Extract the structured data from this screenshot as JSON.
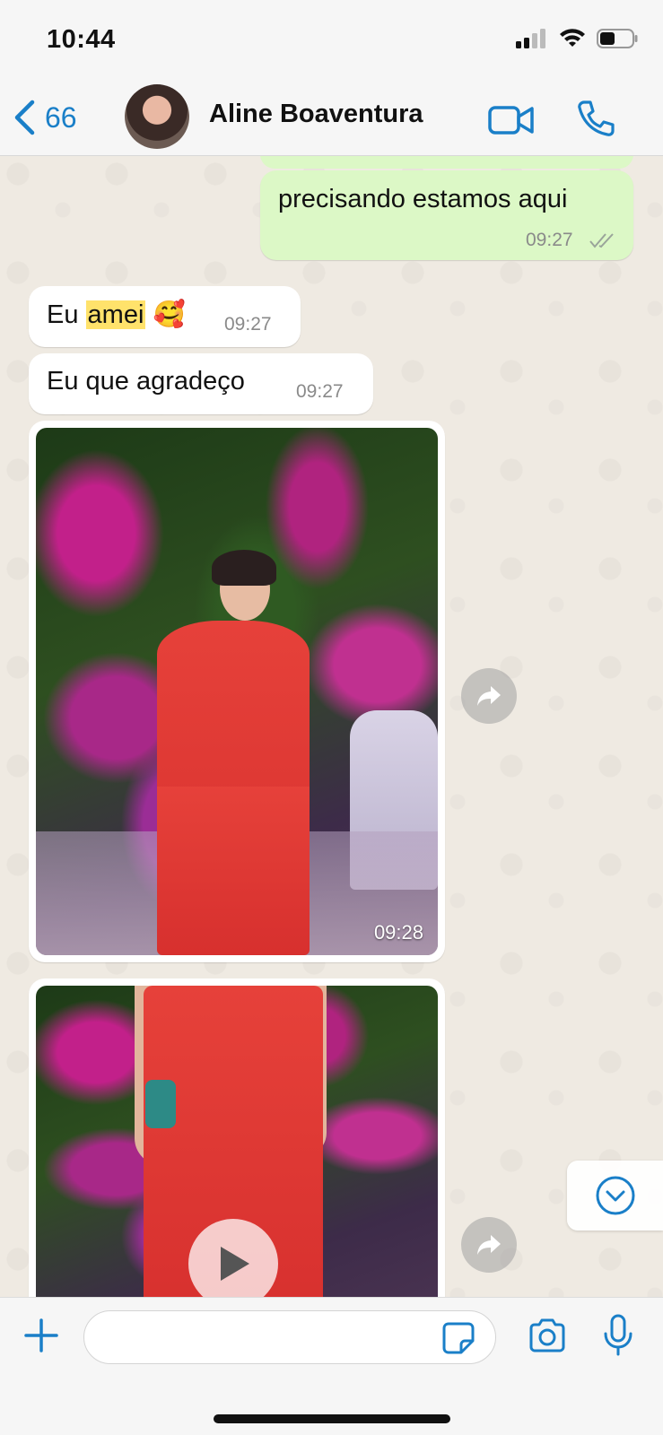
{
  "status_bar": {
    "time": "10:44"
  },
  "header": {
    "back_count": "66",
    "contact_name": "Aline Boaventura"
  },
  "messages": [
    {
      "direction": "out",
      "text": "precisando estamos aqui",
      "time": "09:27",
      "read": true
    },
    {
      "direction": "in",
      "text_before": "Eu ",
      "text_highlight": "amei",
      "emoji": "🥰",
      "time": "09:27"
    },
    {
      "direction": "in",
      "text": "Eu que agradeço",
      "time": "09:27"
    },
    {
      "direction": "in",
      "type": "photo",
      "time": "09:28"
    },
    {
      "direction": "in",
      "type": "video"
    }
  ],
  "icons": {
    "back": "chevron-left-icon",
    "video_call": "video-camera-icon",
    "voice_call": "phone-icon",
    "forward": "forward-icon",
    "play": "play-icon",
    "scroll_down": "chevron-down-circle-icon",
    "attach": "plus-icon",
    "sticker": "sticker-icon",
    "camera": "camera-icon",
    "mic": "microphone-icon"
  },
  "colors": {
    "accent": "#1a7fc8",
    "outgoing_bubble": "#dcf8c6",
    "incoming_bubble": "#ffffff",
    "chat_background": "#efeae2",
    "highlight": "#ffe26b"
  },
  "composer": {
    "placeholder": ""
  }
}
